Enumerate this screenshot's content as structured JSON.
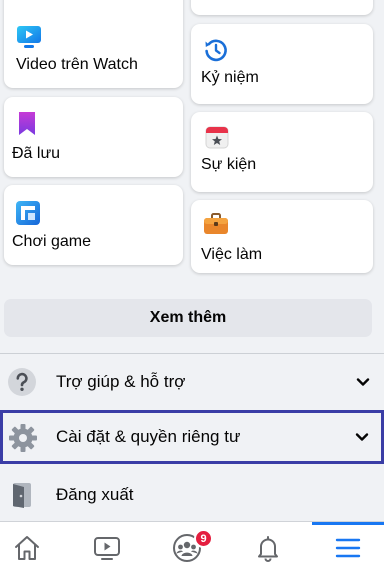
{
  "shortcuts": {
    "video_watch": "Video trên Watch",
    "memories": "Kỷ niệm",
    "saved": "Đã lưu",
    "events": "Sự kiện",
    "gaming": "Chơi game",
    "jobs": "Việc làm"
  },
  "see_more_label": "Xem thêm",
  "menu": {
    "help": "Trợ giúp & hỗ trợ",
    "settings": "Cài đặt & quyền riêng tư",
    "logout": "Đăng xuất"
  },
  "tabbar": {
    "groups_badge": "9"
  },
  "icons": {
    "video_watch": "watch-video-icon",
    "memories": "memories-clock-icon",
    "saved": "bookmark-icon",
    "events": "calendar-star-icon",
    "gaming": "gaming-icon",
    "jobs": "briefcase-icon",
    "help": "question-circle-icon",
    "settings": "gear-icon",
    "logout": "door-exit-icon",
    "tabs": [
      "home-icon",
      "watch-icon",
      "groups-icon",
      "bell-icon",
      "menu-icon"
    ]
  },
  "colors": {
    "accent": "#1877f2",
    "badge": "#e41e3f",
    "highlight_border": "#3a3da6",
    "background": "#f0f2f5"
  }
}
